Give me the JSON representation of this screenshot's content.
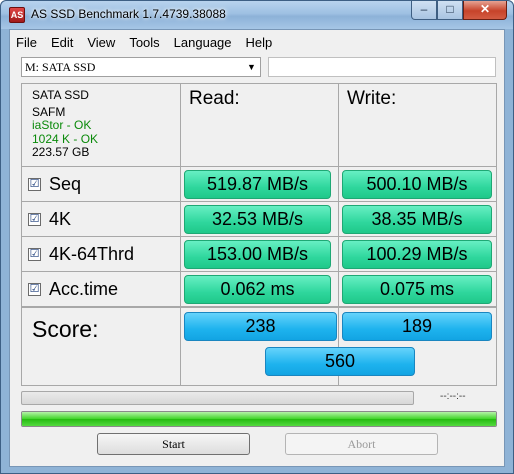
{
  "window": {
    "title": "AS SSD Benchmark 1.7.4739.38088",
    "app_icon": "AS"
  },
  "window_controls": {
    "minimize": "–",
    "maximize": "□",
    "close": "✕"
  },
  "menu": [
    "File",
    "Edit",
    "View",
    "Tools",
    "Language",
    "Help"
  ],
  "drive_select": {
    "value": "M: SATA SSD",
    "arrow": "▼"
  },
  "drive_info": {
    "name": "SATA SSD",
    "firmware": "SAFM",
    "driver_status": "iaStor - OK",
    "alignment_status": "1024 K - OK",
    "capacity": "223.57 GB"
  },
  "columns": {
    "read": "Read:",
    "write": "Write:"
  },
  "tests": [
    {
      "name": "Seq",
      "checked": "☑",
      "read": "519.87 MB/s",
      "write": "500.10 MB/s"
    },
    {
      "name": "4K",
      "checked": "☑",
      "read": "32.53 MB/s",
      "write": "38.35 MB/s"
    },
    {
      "name": "4K-64Thrd",
      "checked": "☑",
      "read": "153.00 MB/s",
      "write": "100.29 MB/s"
    },
    {
      "name": "Acc.time",
      "checked": "☑",
      "read": "0.062 ms",
      "write": "0.075 ms"
    }
  ],
  "score": {
    "label": "Score:",
    "read": "238",
    "write": "189",
    "total": "560"
  },
  "progress": {
    "timer": "--:--:--",
    "top_fraction": 0,
    "main_fraction": 1.0
  },
  "buttons": {
    "start": "Start",
    "abort": "Abort"
  },
  "colors": {
    "result_green": "#2fd79d",
    "score_blue": "#1eb3ee",
    "ok_green": "#0a8a0a",
    "progress_green": "#3fd527"
  }
}
